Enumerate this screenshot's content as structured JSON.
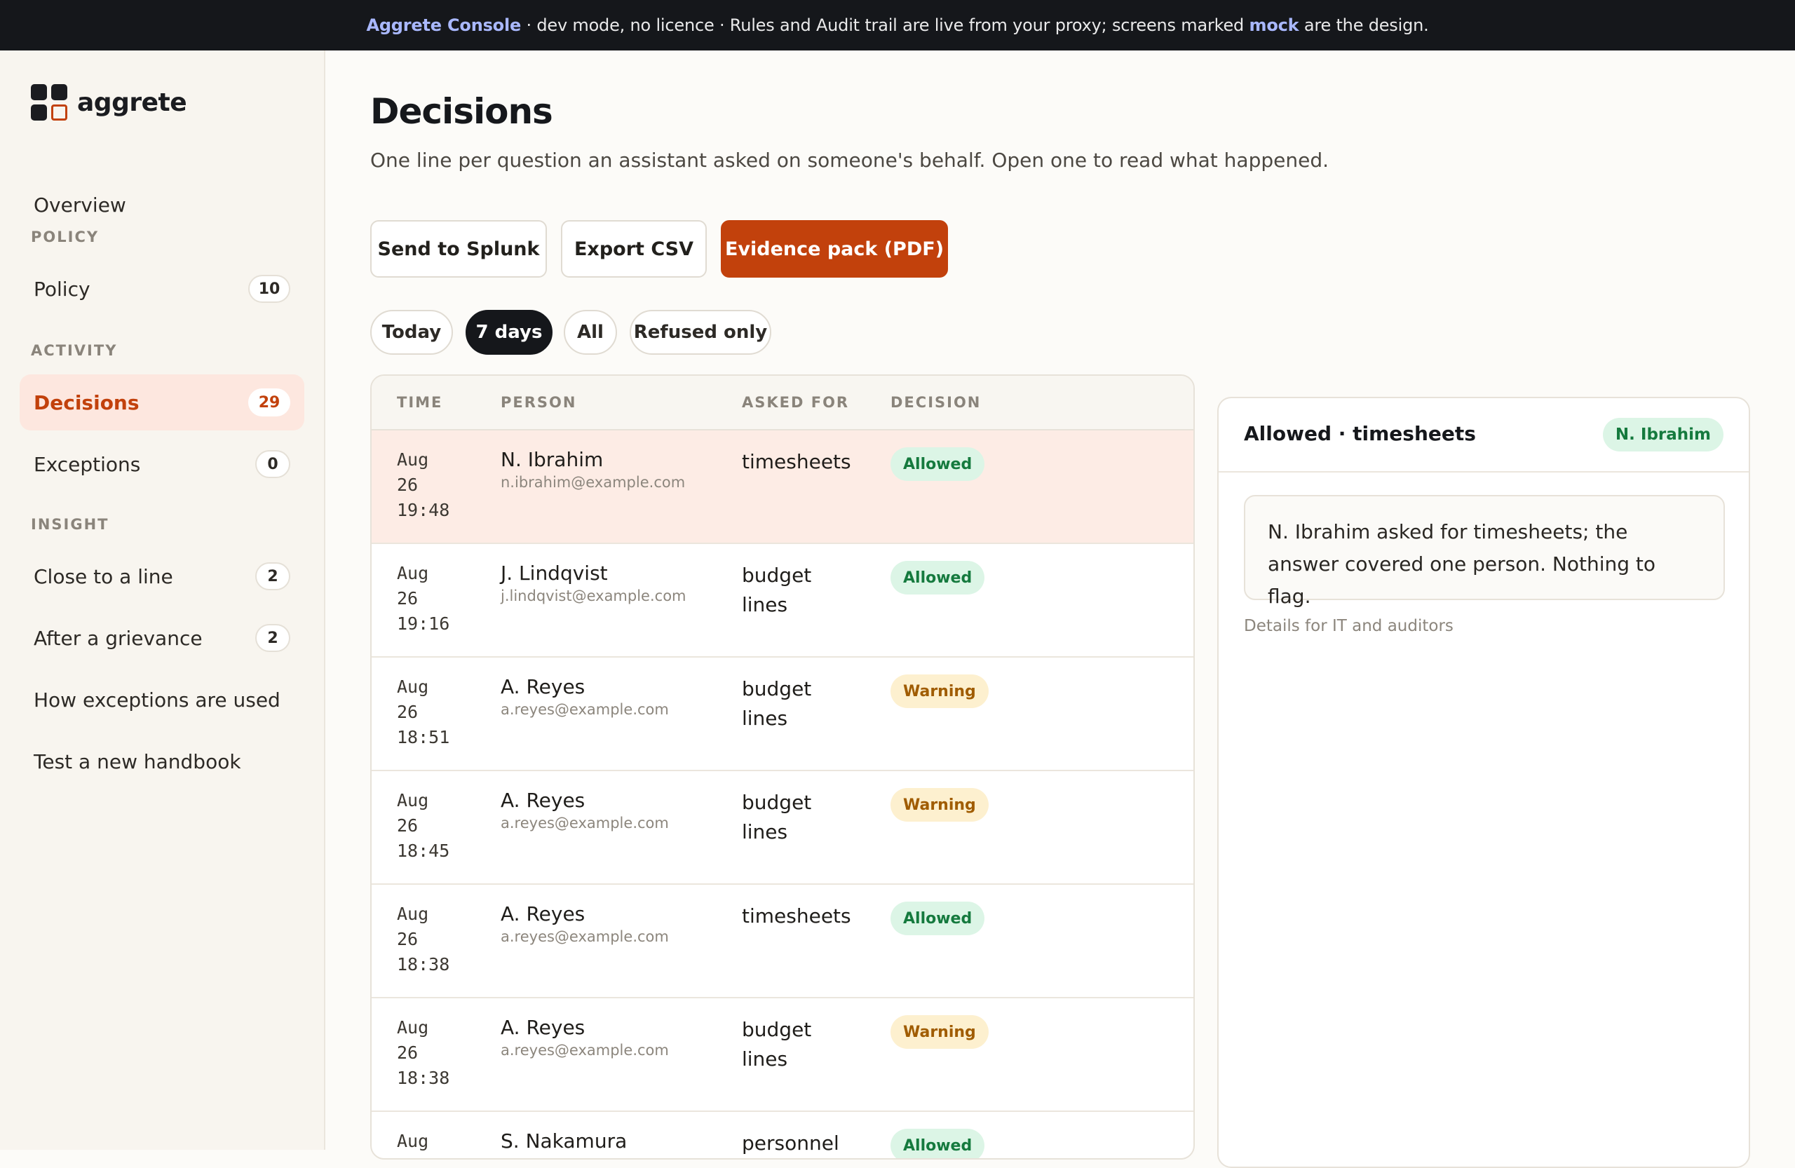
{
  "banner": {
    "app": "Aggrete Console",
    "text1": " · dev mode, no licence · Rules and Audit trail are live from your proxy; screens marked ",
    "mock": "mock",
    "text2": " are the design."
  },
  "brand": {
    "name": "aggrete"
  },
  "sidebar": {
    "overview": "Overview",
    "section_policy": "POLICY",
    "policy": {
      "label": "Policy",
      "count": "10"
    },
    "section_activity": "ACTIVITY",
    "decisions": {
      "label": "Decisions",
      "count": "29"
    },
    "exceptions": {
      "label": "Exceptions",
      "count": "0"
    },
    "section_insight": "INSIGHT",
    "close": {
      "label": "Close to a line",
      "count": "2"
    },
    "grievance": {
      "label": "After a grievance",
      "count": "2"
    },
    "exceptions_used": "How exceptions are used",
    "handbook": "Test a new handbook"
  },
  "page": {
    "title": "Decisions",
    "subtitle": "One line per question an assistant asked on someone's behalf. Open one to read what happened."
  },
  "actions": {
    "splunk": "Send to Splunk",
    "csv": "Export CSV",
    "pdf": "Evidence pack (PDF)"
  },
  "filters": {
    "today": "Today",
    "seven": "7 days",
    "all": "All",
    "refused": "Refused only"
  },
  "table": {
    "headers": {
      "time": "TIME",
      "person": "PERSON",
      "asked": "ASKED FOR",
      "decision": "DECISION"
    },
    "rows": [
      {
        "month": "Aug",
        "day": "26",
        "time": "19:48",
        "name": "N. Ibrahim",
        "email": "n.ibrahim@example.com",
        "asked": "timesheets",
        "decision": "Allowed"
      },
      {
        "month": "Aug",
        "day": "26",
        "time": "19:16",
        "name": "J. Lindqvist",
        "email": "j.lindqvist@example.com",
        "asked": "budget lines",
        "decision": "Allowed"
      },
      {
        "month": "Aug",
        "day": "26",
        "time": "18:51",
        "name": "A. Reyes",
        "email": "a.reyes@example.com",
        "asked": "budget lines",
        "decision": "Warning"
      },
      {
        "month": "Aug",
        "day": "26",
        "time": "18:45",
        "name": "A. Reyes",
        "email": "a.reyes@example.com",
        "asked": "budget lines",
        "decision": "Warning"
      },
      {
        "month": "Aug",
        "day": "26",
        "time": "18:38",
        "name": "A. Reyes",
        "email": "a.reyes@example.com",
        "asked": "timesheets",
        "decision": "Allowed"
      },
      {
        "month": "Aug",
        "day": "26",
        "time": "18:38",
        "name": "A. Reyes",
        "email": "a.reyes@example.com",
        "asked": "budget lines",
        "decision": "Warning"
      },
      {
        "month": "Aug",
        "day": "",
        "time": "",
        "name": "S. Nakamura",
        "email": "",
        "asked": "personnel",
        "decision": "Allowed"
      }
    ]
  },
  "detail": {
    "title": "Allowed · timesheets",
    "person": "N. Ibrahim",
    "note": "N. Ibrahim asked for timesheets; the answer covered one person. Nothing to flag.",
    "details_link": "Details for IT and auditors"
  },
  "colors": {
    "accent": "#c2410c",
    "allowed_bg": "#dcf5e6",
    "allowed_fg": "#157a3e",
    "warning_bg": "#fdf0cf",
    "warning_fg": "#a05c00"
  }
}
